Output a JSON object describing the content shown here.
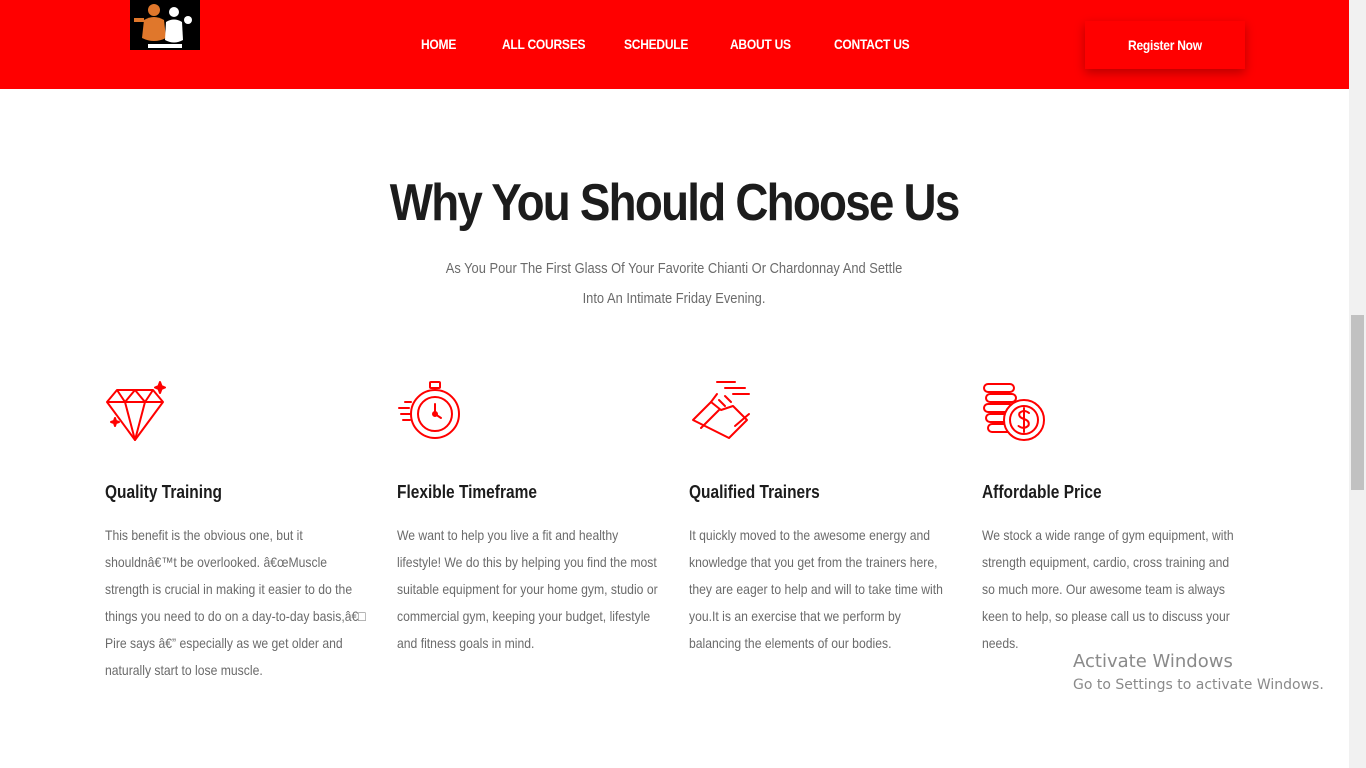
{
  "header": {
    "nav": [
      "HOME",
      "ALL COURSES",
      "SCHEDULE",
      "ABOUT US",
      "CONTACT US"
    ],
    "register_label": "Register Now"
  },
  "section": {
    "title": "Why You Should Choose Us",
    "subtitle": "As You Pour The First Glass Of Your Favorite Chianti Or Chardonnay And Settle Into An Intimate Friday Evening."
  },
  "features": [
    {
      "icon": "diamond-icon",
      "title": "Quality Training",
      "text": "This benefit is the obvious one, but it shouldnâ€™t be overlooked. â€œMuscle strength is crucial in making it easier to do the things you need to do on a day-to-day basis,â€□ Pire says â€” especially as we get older and naturally start to lose muscle."
    },
    {
      "icon": "stopwatch-icon",
      "title": "Flexible Timeframe",
      "text": "We want to help you live a fit and healthy lifestyle! We do this by helping you find the most suitable equipment for your home gym, studio or commercial gym, keeping your budget, lifestyle and fitness goals in mind."
    },
    {
      "icon": "running-shoe-icon",
      "title": "Qualified Trainers",
      "text": "It quickly moved to the awesome energy and knowledge that you get from the trainers here, they are eager to help and will to take time with you.It is an exercise that we perform by balancing the elements of our bodies."
    },
    {
      "icon": "coins-icon",
      "title": "Affordable Price",
      "text": "We stock a wide range of gym equipment, with strength equipment, cardio, cross training and so much more. Our awesome team is always keen to help, so please call us to discuss your needs."
    }
  ],
  "watermark": {
    "line1": "Activate Windows",
    "line2": "Go to Settings to activate Windows."
  },
  "colors": {
    "brand": "#ff0000",
    "heading": "#1c1c1c",
    "body_text": "#6b6b6b"
  }
}
